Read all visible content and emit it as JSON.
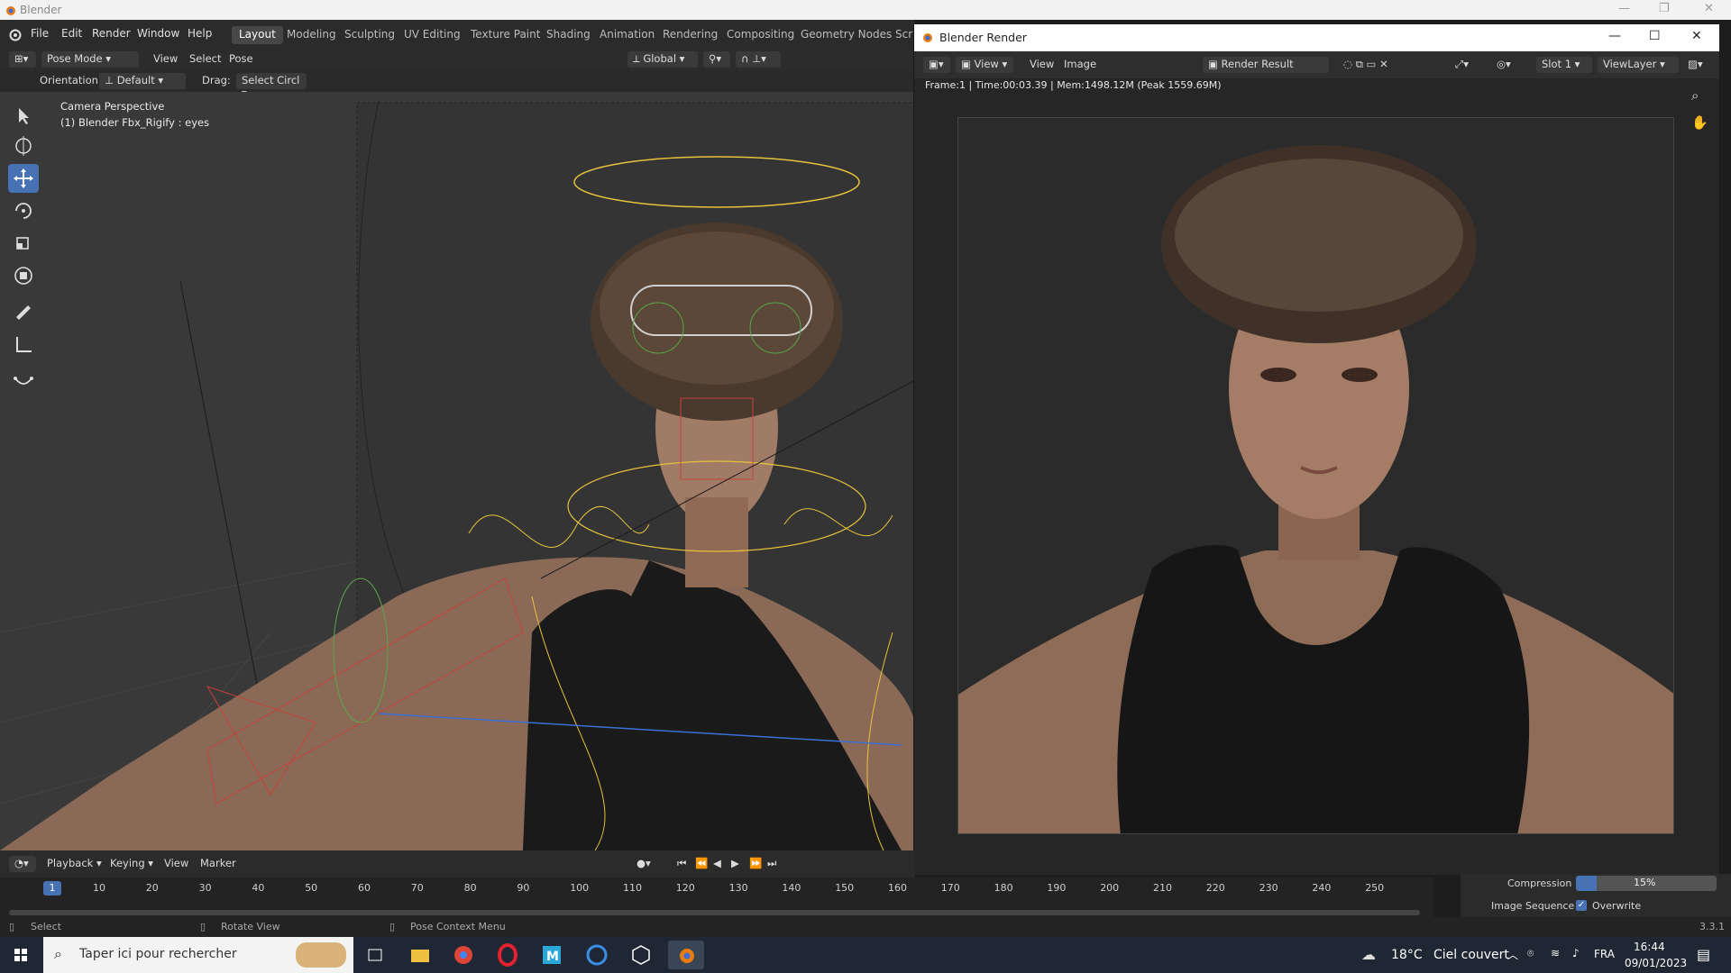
{
  "app": {
    "title": "Blender",
    "version": "3.3.1"
  },
  "menubar": {
    "items": [
      "File",
      "Edit",
      "Render",
      "Window",
      "Help"
    ],
    "workspaces": [
      "Layout",
      "Modeling",
      "Sculpting",
      "UV Editing",
      "Texture Paint",
      "Shading",
      "Animation",
      "Rendering",
      "Compositing",
      "Geometry Nodes",
      "Scri"
    ],
    "active_workspace": "Layout"
  },
  "viewport_header": {
    "mode": "Pose Mode",
    "menus": [
      "View",
      "Select",
      "Pose"
    ],
    "transform": "Global"
  },
  "tool_header": {
    "orientation_label": "Orientation:",
    "orientation_value": "Default",
    "drag_label": "Drag:",
    "drag_value": "Select Circl"
  },
  "viewport": {
    "info_line1": "Camera Perspective",
    "info_line2": "(1) Blender Fbx_Rigify : eyes"
  },
  "render_window": {
    "title": "Blender Render",
    "menus": [
      "View",
      "View",
      "Image"
    ],
    "image_name": "Render Result",
    "slot": "Slot 1",
    "view_layer": "ViewLayer",
    "status": "Frame:1 | Time:00:03.39 | Mem:1498.12M (Peak 1559.69M)"
  },
  "timeline_header": {
    "menus": [
      "Playback",
      "Keying",
      "View",
      "Marker"
    ]
  },
  "timeline": {
    "current_frame": "1",
    "ticks": [
      "10",
      "20",
      "30",
      "40",
      "50",
      "60",
      "70",
      "80",
      "90",
      "100",
      "110",
      "120",
      "130",
      "140",
      "150",
      "160",
      "170",
      "180",
      "190",
      "200",
      "210",
      "220",
      "230",
      "240",
      "250"
    ]
  },
  "right_props": {
    "compression_label": "Compression",
    "compression_value": "15%",
    "compression_fraction": 0.15,
    "image_sequence_label": "Image Sequence",
    "overwrite_label": "Overwrite"
  },
  "statusbar": {
    "select": "Select",
    "rotate": "Rotate View",
    "context": "Pose Context Menu",
    "version": "3.3.1"
  },
  "taskbar": {
    "search_placeholder": "Taper ici pour rechercher",
    "weather_temp": "18°C",
    "weather_text": "Ciel couvert",
    "language": "FRA",
    "time": "16:44",
    "date": "09/01/2023"
  },
  "colors": {
    "accent": "#4772b3",
    "rig_yellow": "#e6c33a",
    "rig_red": "#c8403a",
    "rig_green": "#59a84b",
    "rig_blue": "#3b6fd6"
  }
}
